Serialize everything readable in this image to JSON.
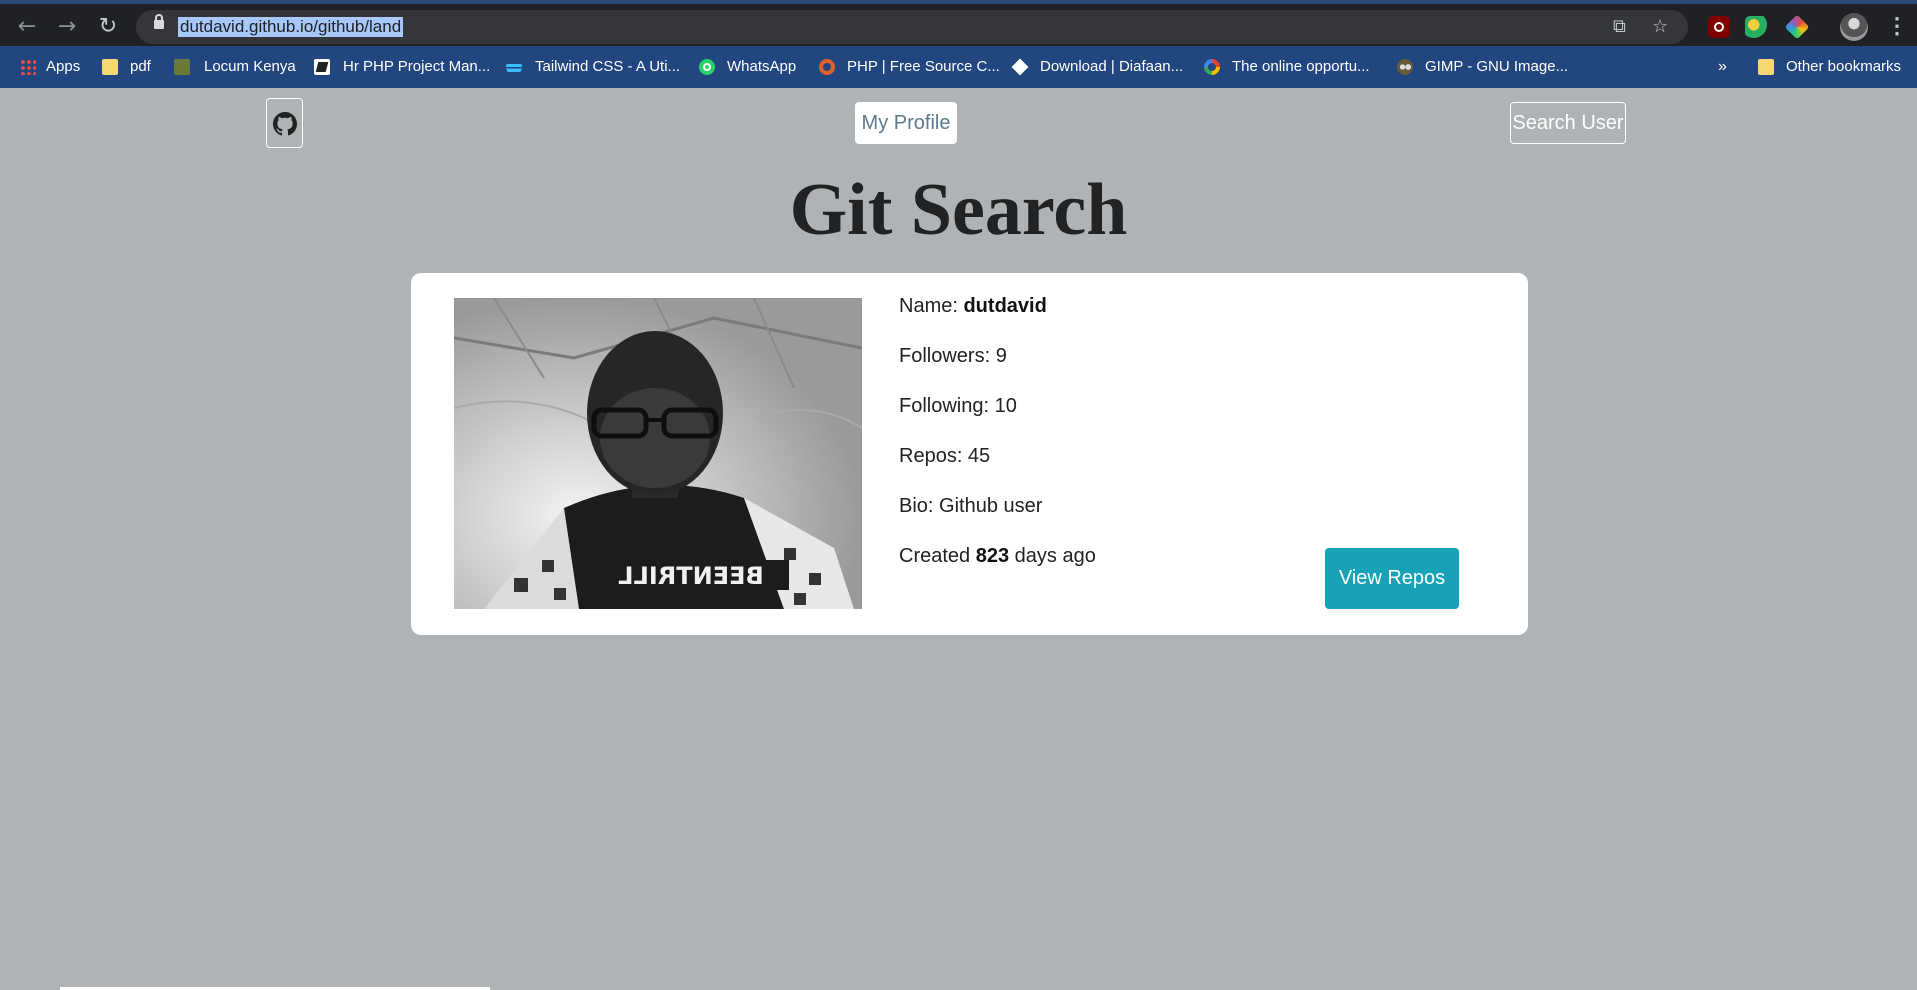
{
  "browser": {
    "url": "dutdavid.github.io/github/land",
    "bookmarks": [
      {
        "label": "Apps",
        "icon": "apps-grid-icon"
      },
      {
        "label": "pdf",
        "icon": "folder-icon"
      },
      {
        "label": "Locum Kenya",
        "icon": "locum-kenya-icon"
      },
      {
        "label": "Hr PHP Project Man...",
        "icon": "hr-php-icon"
      },
      {
        "label": "Tailwind CSS - A Uti...",
        "icon": "tailwind-icon"
      },
      {
        "label": "WhatsApp",
        "icon": "whatsapp-icon"
      },
      {
        "label": "PHP | Free Source C...",
        "icon": "php-source-icon"
      },
      {
        "label": "Download | Diafaan...",
        "icon": "diafaan-icon"
      },
      {
        "label": "The online opportu...",
        "icon": "google-icon"
      },
      {
        "label": "GIMP - GNU Image...",
        "icon": "gimp-icon"
      }
    ],
    "more_bookmarks": "»",
    "other_bookmarks": "Other bookmarks"
  },
  "nav": {
    "my_profile": "My Profile",
    "search_user": "Search User"
  },
  "page": {
    "title": "Git Search"
  },
  "profile": {
    "name_label": "Name: ",
    "name": "dutdavid",
    "followers": "Followers: 9",
    "following": "Following: 10",
    "repos": "Repos: 45",
    "bio": "Bio: Github user",
    "created_prefix": "Created ",
    "created_days": "823",
    "created_suffix": " days ago",
    "shirt_text": "BEENTRILL",
    "view_repos": "View Repos"
  },
  "colors": {
    "page_bg": "#afb3b5",
    "button_accent": "#17a2b8",
    "bookmarks_bar": "#22467f"
  }
}
